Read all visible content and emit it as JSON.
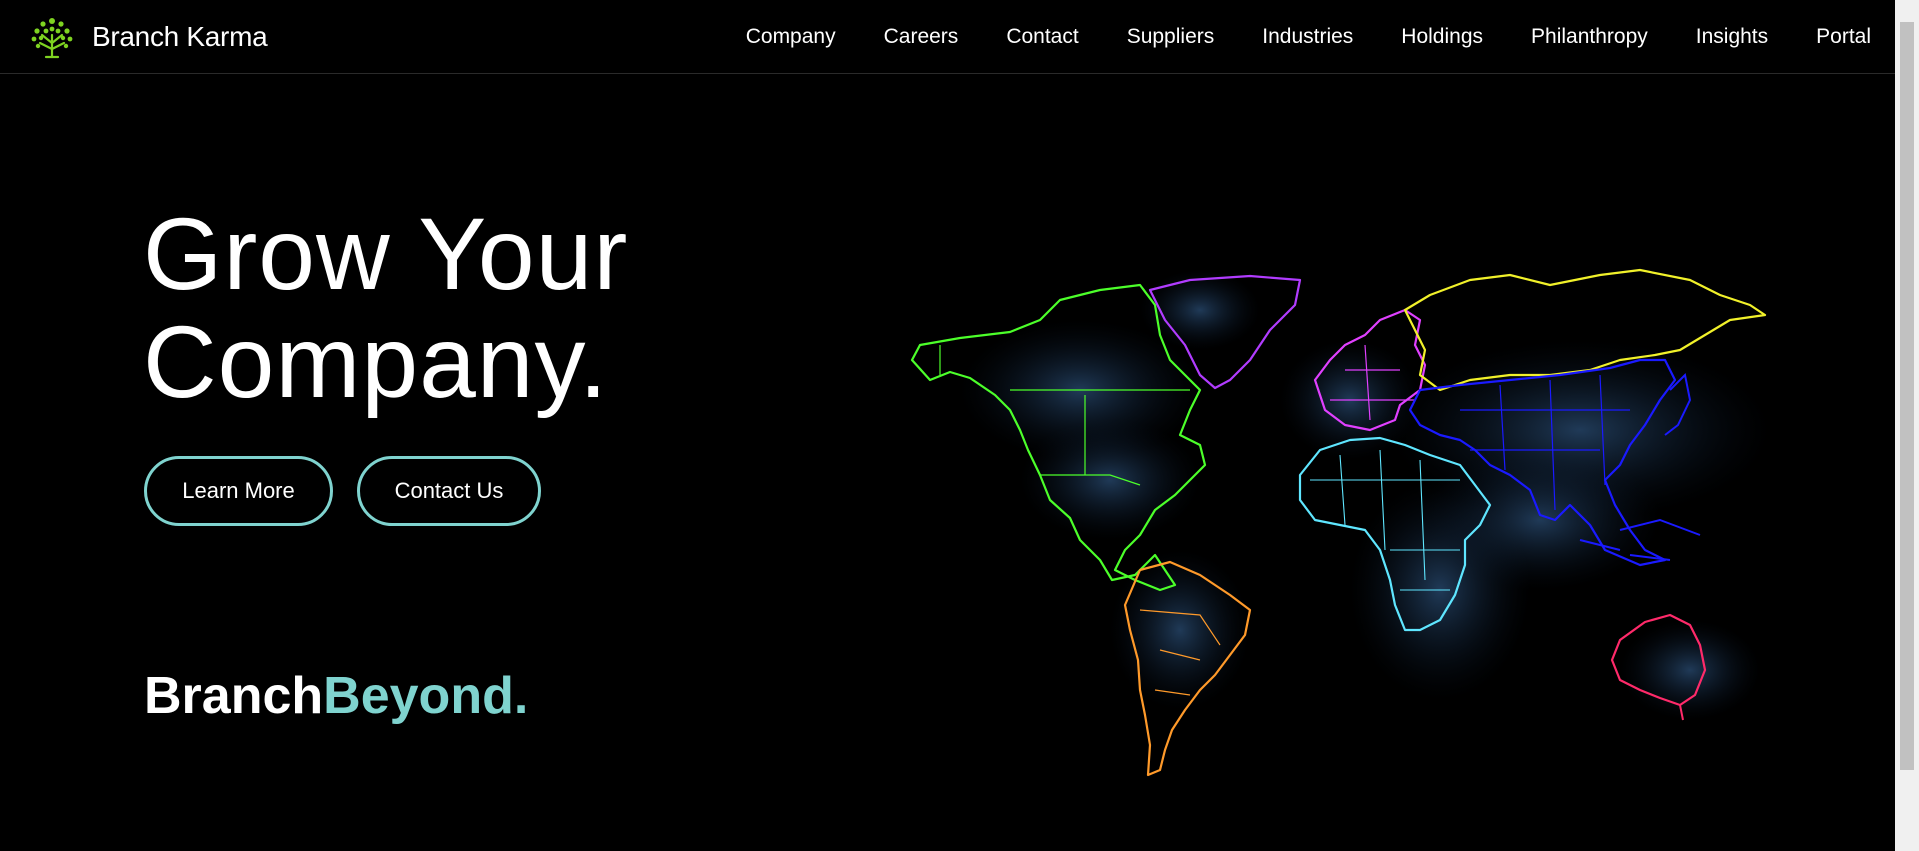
{
  "header": {
    "brand_name": "Branch Karma",
    "brand_icon": "tree-logo-icon",
    "nav": [
      {
        "label": "Company"
      },
      {
        "label": "Careers"
      },
      {
        "label": "Contact"
      },
      {
        "label": "Suppliers"
      },
      {
        "label": "Industries"
      },
      {
        "label": "Holdings"
      },
      {
        "label": "Philanthropy"
      },
      {
        "label": "Insights"
      },
      {
        "label": "Portal"
      }
    ]
  },
  "hero": {
    "title_line1": "Grow Your",
    "title_line2": "Company.",
    "learn_more_label": "Learn More",
    "contact_us_label": "Contact Us",
    "tagline_part1": "Branch",
    "tagline_part2": "Beyond."
  },
  "colors": {
    "accent": "#7fd3cf",
    "logo_green": "#7ed321",
    "north_america": "#4cff2a",
    "greenland": "#b13cff",
    "south_america": "#ff9a2a",
    "europe": "#e040ff",
    "africa": "#5fe6ff",
    "asia": "#1a1aff",
    "russia": "#f1f12a",
    "australia": "#ff2a6a"
  }
}
